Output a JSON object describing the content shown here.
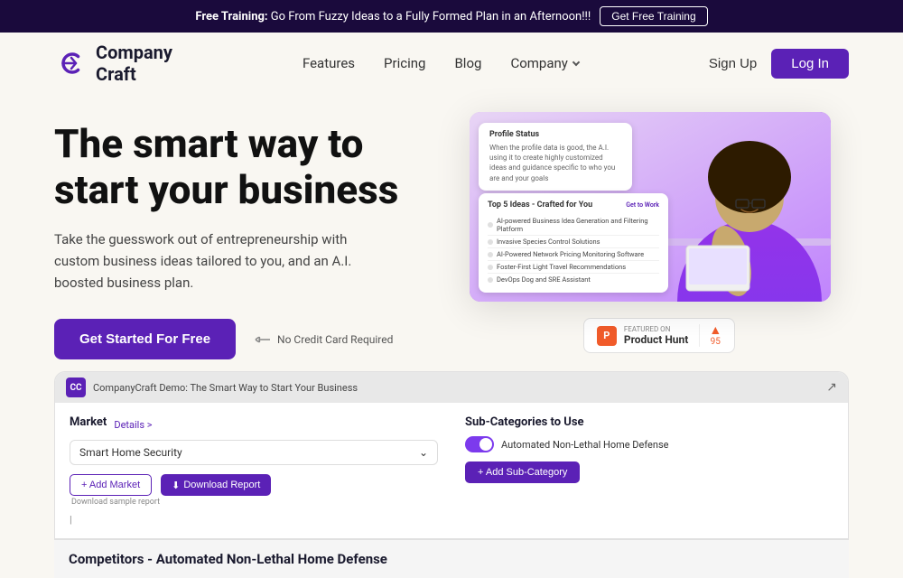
{
  "banner": {
    "text_bold": "Free Training:",
    "text": " Go From Fuzzy Ideas to a Fully Formed Plan in an Afternoon!!!",
    "button_label": "Get Free Training"
  },
  "navbar": {
    "logo_text_line1": "Company",
    "logo_text_line2": "Craft",
    "links": [
      {
        "label": "Features",
        "id": "features"
      },
      {
        "label": "Pricing",
        "id": "pricing"
      },
      {
        "label": "Blog",
        "id": "blog"
      },
      {
        "label": "Company",
        "id": "company"
      }
    ],
    "sign_up": "Sign Up",
    "login": "Log In"
  },
  "hero": {
    "title": "The smart way to start your business",
    "subtitle": "Take the guesswork out of entrepreneurship with custom business ideas tailored to you, and an A.I. boosted business plan.",
    "cta_label": "Get Started For Free",
    "no_credit": "No Credit Card Required"
  },
  "hero_cards": {
    "profile_card_title": "Profile Status",
    "profile_card_text": "When the profile data is good, the A.I. using it to create highly customized ideas and guidance specific to who you are and your goals",
    "ideas_card_title": "Top 5 Ideas - Crafted for You",
    "ideas_card_cta": "Get to Work",
    "ideas": [
      "AI-powered Business Idea Generation and Filtering Platform",
      "Invasive Species Control Solutions",
      "AI-Powered Network Pricing Monitoring Software",
      "Foster-First Light Travel Recommendations",
      "DevOps Dog and SRE Assistant"
    ]
  },
  "product_hunt": {
    "featured_text": "FEATURED ON",
    "name": "Product Hunt",
    "votes": "95"
  },
  "demo": {
    "logo_label": "CC",
    "title": "CompanyCraft Demo: The Smart Way to Start Your Business",
    "share_icon": "↗",
    "market_label": "Market",
    "details_link": "Details >",
    "market_value": "Smart Home Security",
    "add_market_label": "+ Add Market",
    "download_label": "Download Report",
    "download_icon": "⬇",
    "download_sub": "Download sample report",
    "sub_categories_label": "Sub-Categories to Use",
    "toggle_text": "Automated Non-Lethal Home Defense",
    "add_sub_label": "+ Add Sub-Category",
    "cursor_char": "|"
  },
  "competitors": {
    "title": "Competitors - Automated Non-Lethal Home Defense"
  },
  "colors": {
    "purple": "#5b21b6",
    "dark_purple": "#1a0a3c",
    "light_bg": "#f9f7f2"
  }
}
